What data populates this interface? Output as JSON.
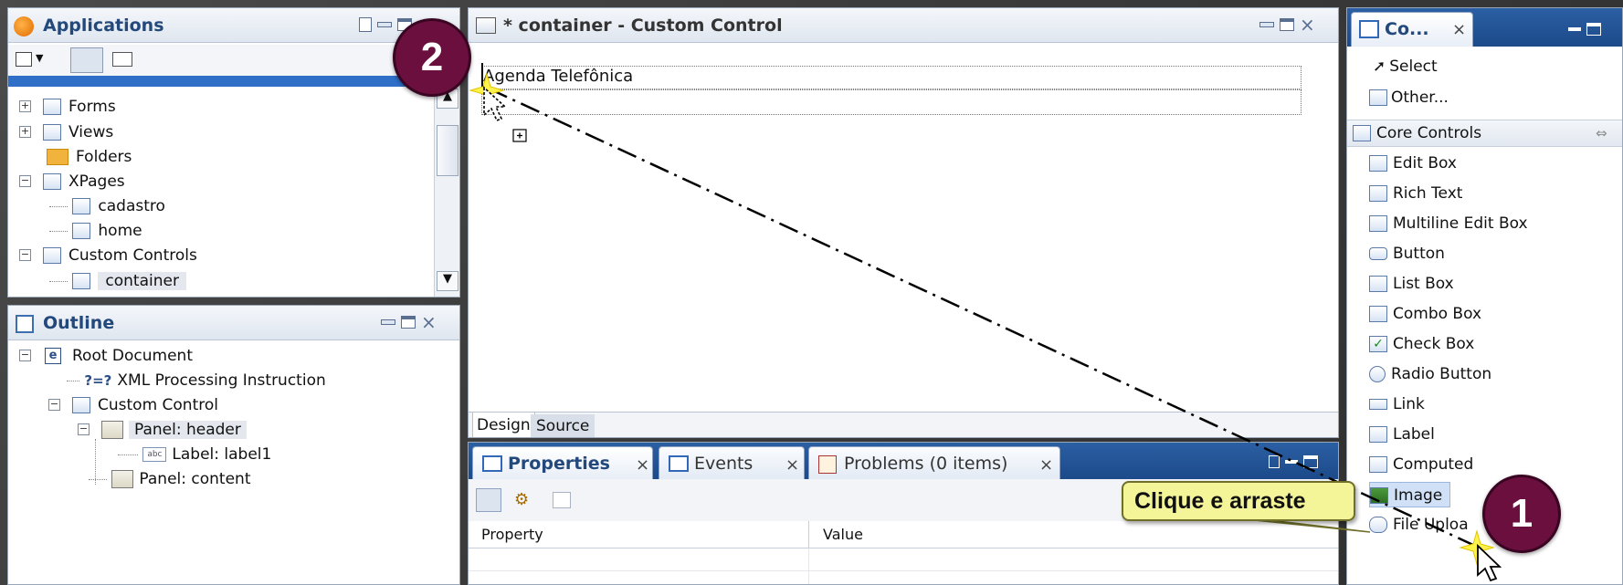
{
  "applications": {
    "title": "Applications",
    "tree": [
      {
        "label": "Forms"
      },
      {
        "label": "Views"
      },
      {
        "label": "Folders"
      },
      {
        "label": "XPages"
      },
      {
        "label": "cadastro"
      },
      {
        "label": "home"
      },
      {
        "label": "Custom Controls"
      },
      {
        "label": "container"
      }
    ]
  },
  "outline": {
    "title": "Outline",
    "tree": [
      {
        "label": "Root Document"
      },
      {
        "label": "XML Processing Instruction"
      },
      {
        "label": "Custom Control"
      },
      {
        "label": "Panel: header"
      },
      {
        "label": "Label: label1"
      },
      {
        "label": "Panel: content"
      }
    ]
  },
  "editor": {
    "title": "* container - Custom Control",
    "label_text": "Agenda Telefônica",
    "tabs": [
      "Design",
      "Source"
    ]
  },
  "bottom": {
    "tabs": [
      "Properties",
      "Events",
      "Problems (0 items)"
    ],
    "columns": [
      "Property",
      "Value"
    ]
  },
  "palette": {
    "tab_label": "Co...",
    "select": "Select",
    "other": "Other...",
    "category": "Core Controls",
    "items": [
      "Edit Box",
      "Rich Text",
      "Multiline Edit Box",
      "Button",
      "List Box",
      "Combo Box",
      "Check Box",
      "Radio Button",
      "Link",
      "Label",
      "Computed",
      "Image",
      "File Uploa"
    ]
  },
  "annotations": {
    "step1": "1",
    "step2": "2",
    "callout": "Clique e arraste"
  },
  "colors": {
    "step_badge": "#6b0f3f",
    "callout_bg": "#f4f598",
    "panel_header_dark": "#1f4f8f"
  }
}
